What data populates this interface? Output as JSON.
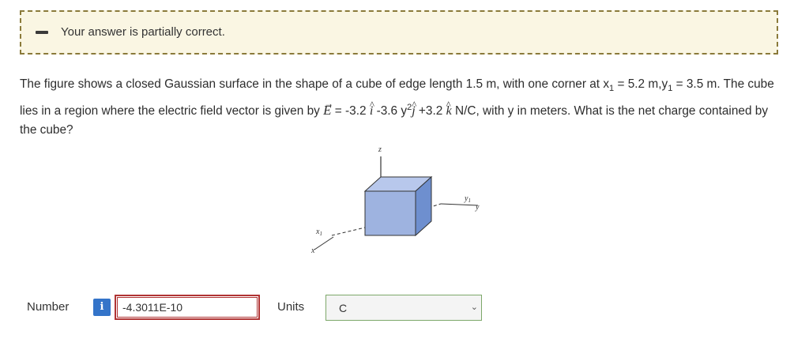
{
  "feedback": {
    "message": "Your answer is partially correct."
  },
  "question": {
    "part1": "The figure shows a closed Gaussian surface in the shape of a cube of edge length 1.5 m, with one corner at x",
    "sub1": "1",
    "part2": " = 5.2 m,y",
    "sub2": "1",
    "part3": " = 3.5 m. The cube lies in a region where the electric field vector is given by ",
    "e_symbol": "E",
    "arrow": "→",
    "part4": " = -3.2 ",
    "i_symbol": "i",
    "i_hat": "^",
    "part5": " -3.6 y",
    "sup2": "2",
    "j_symbol": "j",
    "j_hat": "^",
    "part6": " +3.2 ",
    "k_symbol": "k",
    "k_hat": "^",
    "part7": " N/C, with y in meters. What is the net charge contained by the cube?"
  },
  "figure": {
    "z_label": "z",
    "y_label": "y",
    "y1_label": "y",
    "y1_sub": "1",
    "x_label": "x",
    "x1_label": "x",
    "x1_sub": "1"
  },
  "answer": {
    "number_label": "Number",
    "info_icon_text": "i",
    "number_value": "-4.3011E-10",
    "units_label": "Units",
    "units_value": "C"
  }
}
